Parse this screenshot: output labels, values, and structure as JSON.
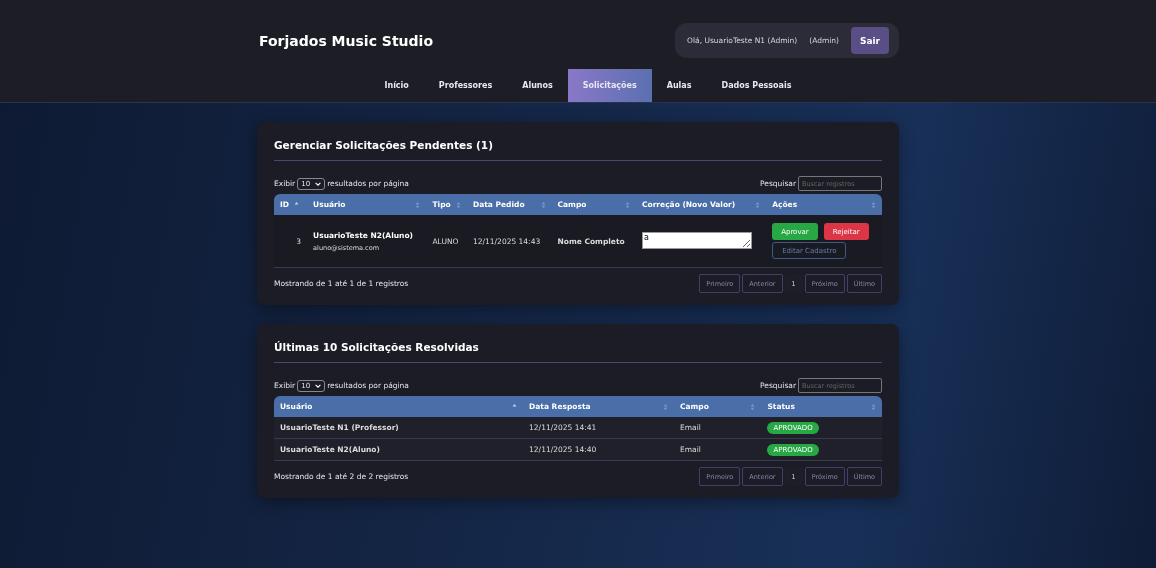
{
  "header": {
    "title": "Forjados Music Studio",
    "greeting": "Olá, UsuarioTeste N1 (Admin)",
    "role": "(Admin)",
    "logout": "Sair"
  },
  "nav": [
    {
      "label": "Início",
      "selected": false
    },
    {
      "label": "Professores",
      "selected": false
    },
    {
      "label": "Alunos",
      "selected": false
    },
    {
      "label": "Solicitações",
      "selected": true
    },
    {
      "label": "Aulas",
      "selected": false
    },
    {
      "label": "Dados Pessoais",
      "selected": false
    }
  ],
  "pending": {
    "title": "Gerenciar Solicitações Pendentes (1)",
    "show_before": "Exibir",
    "page_size": "10",
    "show_after": "resultados por página",
    "search_label": "Pesquisar",
    "search_placeholder": "Buscar registros",
    "columns": [
      {
        "label": "ID",
        "sorted": true
      },
      {
        "label": "Usuário",
        "sorted": false
      },
      {
        "label": "Tipo",
        "sorted": false
      },
      {
        "label": "Data Pedido",
        "sorted": false
      },
      {
        "label": "Campo",
        "sorted": false
      },
      {
        "label": "Correção (Novo Valor)",
        "sorted": false
      },
      {
        "label": "Ações",
        "sorted": false
      }
    ],
    "rows": [
      {
        "id": "3",
        "user": "UsuarioTeste N2(Aluno)",
        "email": "aluno@sistema.com",
        "type": "ALUNO",
        "date": "12/11/2025 14:43",
        "field": "Nome Completo",
        "new_value": "a",
        "approve": "Aprovar",
        "reject": "Rejeitar",
        "edit": "Editar Cadastro"
      }
    ],
    "info": "Mostrando de 1 até 1 de 1 registros",
    "pager": [
      {
        "label": "Primeiro",
        "selected": false
      },
      {
        "label": "Anterior",
        "selected": false
      },
      {
        "label": "1",
        "selected": true
      },
      {
        "label": "Próximo",
        "selected": false
      },
      {
        "label": "Último",
        "selected": false
      }
    ]
  },
  "resolved": {
    "title": "Últimas 10 Solicitações Resolvidas",
    "show_before": "Exibir",
    "page_size": "10",
    "show_after": "resultados por página",
    "search_label": "Pesquisar",
    "search_placeholder": "Buscar registros",
    "columns": [
      {
        "label": "Usuário",
        "sorted": true
      },
      {
        "label": "Data Resposta",
        "sorted": false
      },
      {
        "label": "Campo",
        "sorted": false
      },
      {
        "label": "Status",
        "sorted": false
      }
    ],
    "rows": [
      {
        "user": "UsuarioTeste N1 (Professor)",
        "date": "12/11/2025 14:41",
        "field": "Email",
        "status": "APROVADO",
        "color": "#28a745"
      },
      {
        "user": "UsuarioTeste N2(Aluno)",
        "date": "12/11/2025 14:40",
        "field": "Email",
        "status": "APROVADO",
        "color": "#28a745"
      }
    ],
    "info": "Mostrando de 1 até 2 de 2 registros",
    "pager": [
      {
        "label": "Primeiro",
        "selected": false
      },
      {
        "label": "Anterior",
        "selected": false
      },
      {
        "label": "1",
        "selected": true
      },
      {
        "label": "Próximo",
        "selected": false
      },
      {
        "label": "Último",
        "selected": false
      }
    ]
  }
}
